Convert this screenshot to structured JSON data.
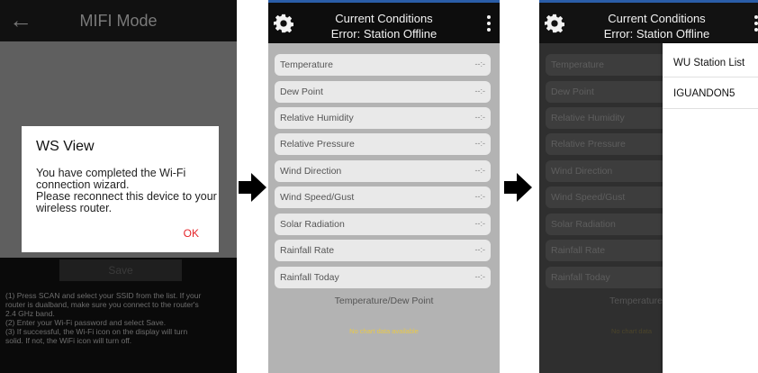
{
  "panel1": {
    "title": "MIFI Mode",
    "dialog": {
      "title": "WS View",
      "message_lines": [
        "You have completed the Wi-Fi",
        "connection wizard.",
        "Please reconnect this device to your",
        "wireless router."
      ],
      "ok_label": "OK"
    },
    "save_label": "Save",
    "instructions": [
      "(1) Press SCAN and select your SSID from the list. If your",
      "router is dualband, make sure you connect to the router's",
      "2.4 GHz band.",
      " (2) Enter your Wi-Fi password and select Save.",
      " (3) If successful, the Wi-Fi icon on the display will turn",
      "solid. If not, the WiFi icon will turn off."
    ]
  },
  "panel2": {
    "header_title": "Current Conditions",
    "header_status": "Error: Station Offline",
    "rows": [
      {
        "label": "Temperature",
        "value": "--:-"
      },
      {
        "label": "Dew Point",
        "value": "--:-"
      },
      {
        "label": "Relative Humidity",
        "value": "--:-"
      },
      {
        "label": "Relative Pressure",
        "value": "--:-"
      },
      {
        "label": "Wind Direction",
        "value": "--:-"
      },
      {
        "label": "Wind Speed/Gust",
        "value": "--:-"
      },
      {
        "label": "Solar Radiation",
        "value": "--:-"
      },
      {
        "label": "Rainfall Rate",
        "value": "--:-"
      },
      {
        "label": "Rainfall Today",
        "value": "--:-"
      }
    ],
    "chart_title": "Temperature/Dew Point",
    "no_data_text": "No chart data available"
  },
  "panel3": {
    "header_title": "Current Conditions",
    "header_status": "Error: Station Offline",
    "rows": [
      {
        "label": "Temperature"
      },
      {
        "label": "Dew Point"
      },
      {
        "label": "Relative Humidity"
      },
      {
        "label": "Relative Pressure"
      },
      {
        "label": "Wind Direction"
      },
      {
        "label": "Wind Speed/Gust"
      },
      {
        "label": "Solar Radiation"
      },
      {
        "label": "Rainfall Rate"
      },
      {
        "label": "Rainfall Today"
      }
    ],
    "chart_title": "Temperature/D",
    "no_data_text": "No chart data",
    "menu": [
      "WU Station List",
      "IGUANDON5"
    ]
  },
  "colors": {
    "accent": "#2a5da8",
    "ok": "#e5252a",
    "no_data": "#e8c94a"
  }
}
